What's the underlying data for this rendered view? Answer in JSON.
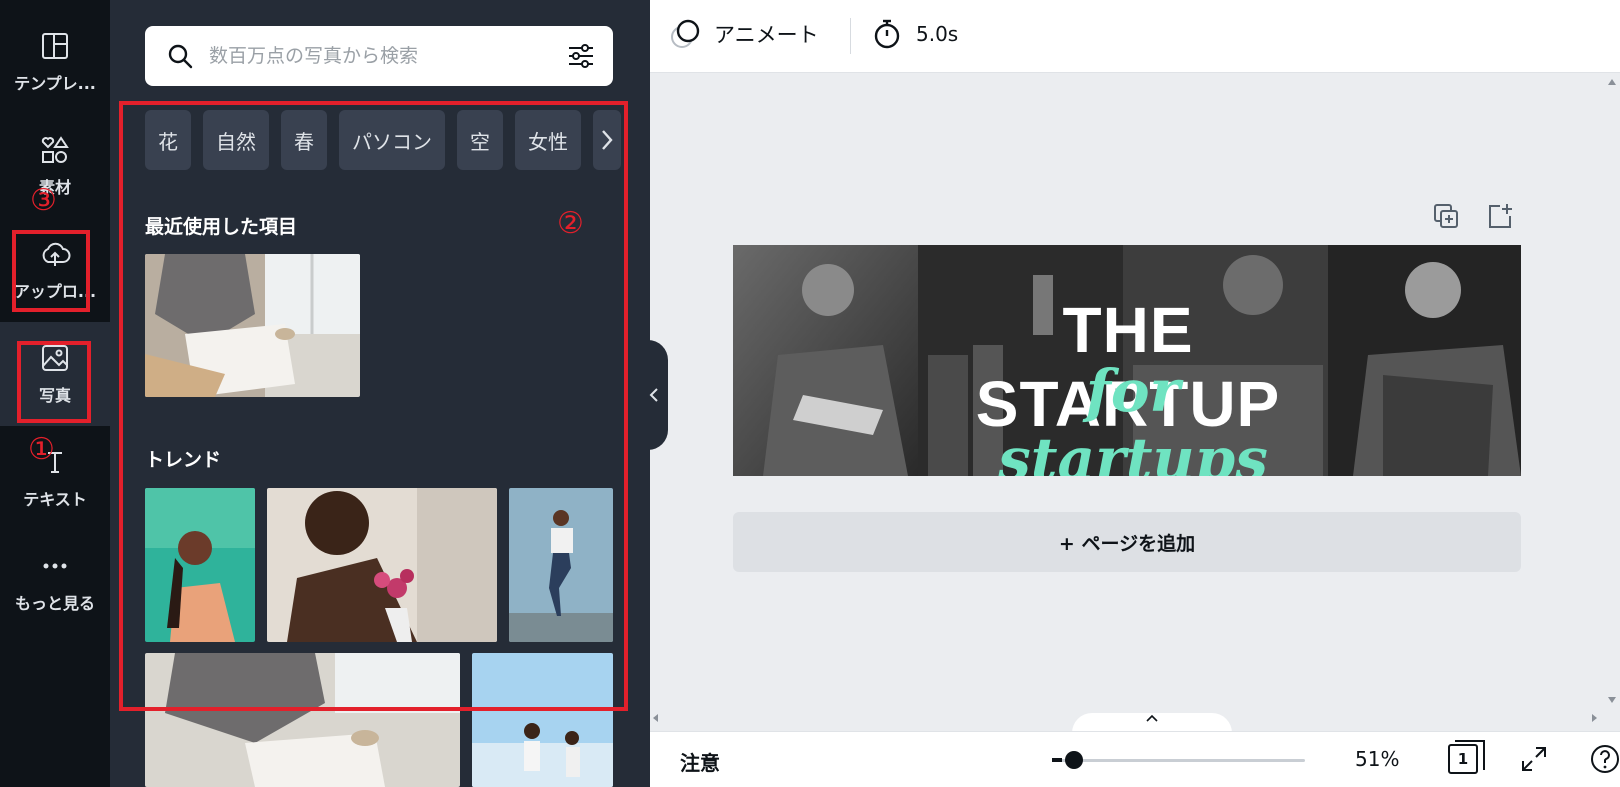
{
  "rail": {
    "templates": "テンプレ...",
    "elements": "素材",
    "uploads": "アップロ...",
    "photos": "写真",
    "text": "テキスト",
    "more": "もっと見る"
  },
  "panel": {
    "search_placeholder": "数百万点の写真から検索",
    "chips": [
      "花",
      "自然",
      "春",
      "パソコン",
      "空",
      "女性"
    ],
    "recent_title": "最近使用した項目",
    "trend_title": "トレンド"
  },
  "topbar": {
    "animate": "アニメート",
    "duration": "5.0s"
  },
  "design": {
    "title": "THE STARTUP",
    "subtitle": "for startups"
  },
  "canvas": {
    "add_page": "+ ページを追加"
  },
  "bottombar": {
    "notice": "注意",
    "zoom": "51%",
    "zoom_value": 0.1,
    "page_count": "1"
  },
  "annotations": {
    "one": "①",
    "two": "②",
    "three": "③"
  },
  "colors": {
    "annotation_red": "#e3202b",
    "accent_mint": "#6fe3c1",
    "rail_bg": "#0e1318",
    "panel_bg": "#252c37"
  }
}
